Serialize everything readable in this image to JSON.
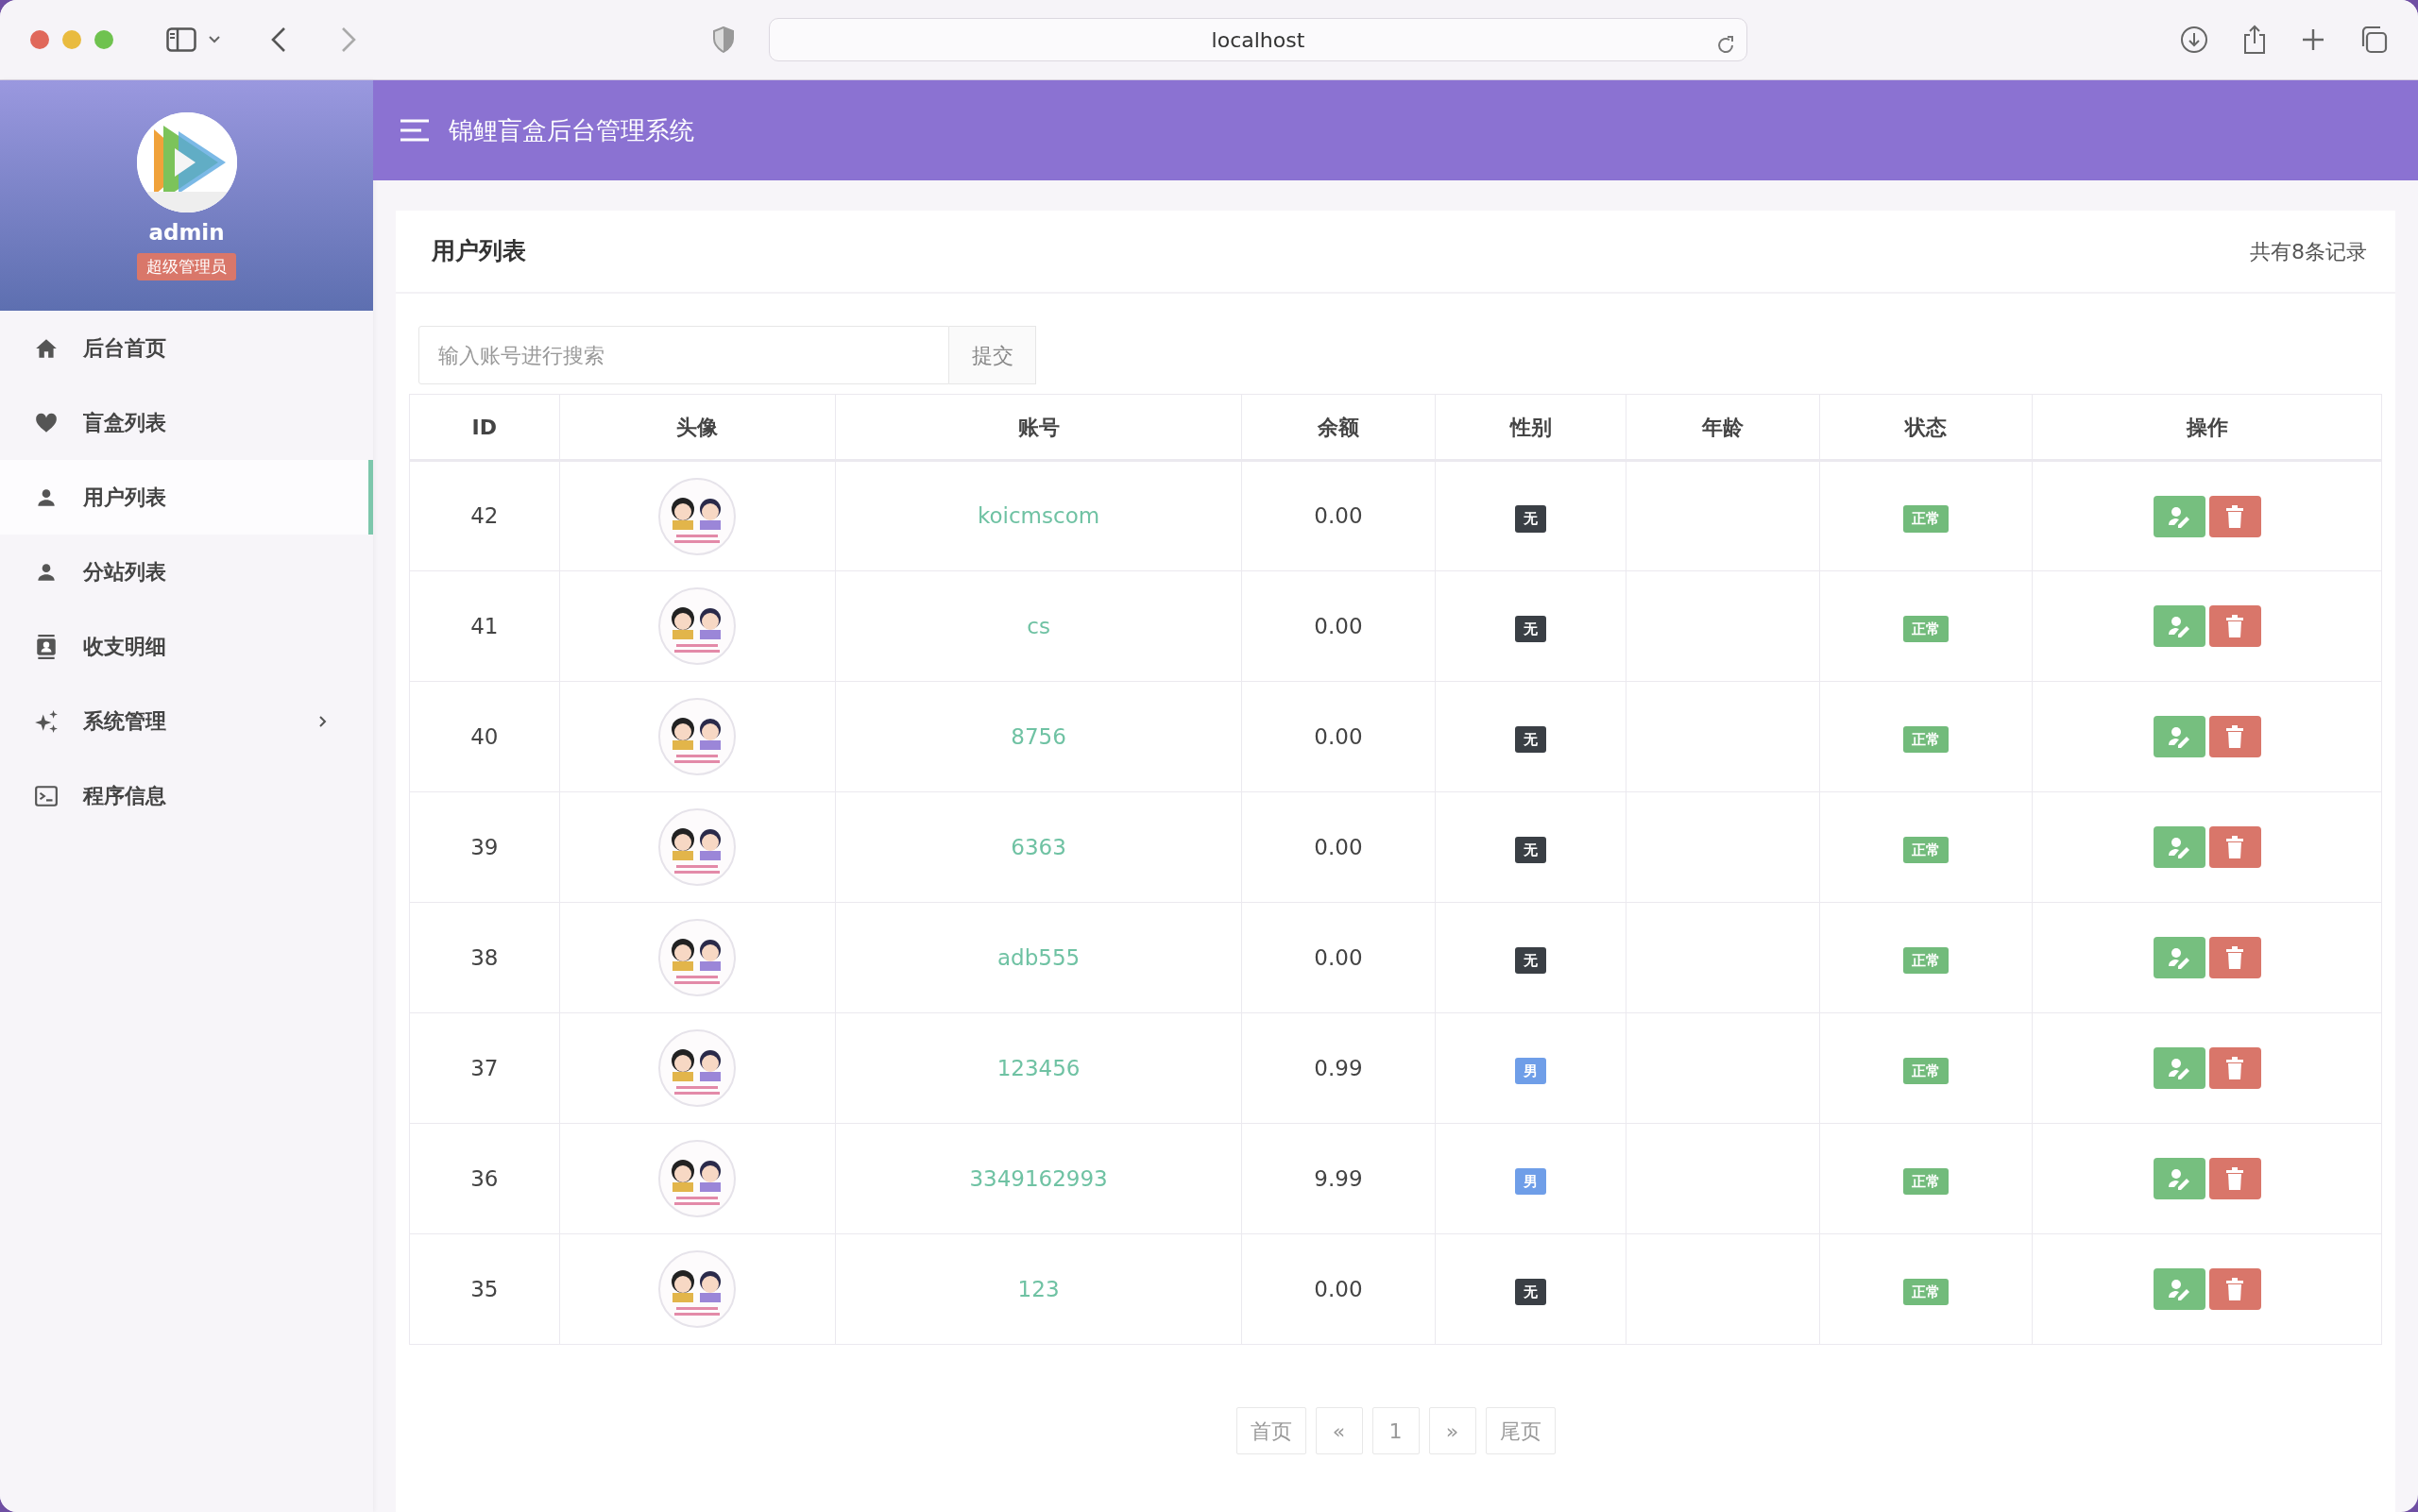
{
  "browser": {
    "url": "localhost"
  },
  "sidebar": {
    "user": {
      "name": "admin",
      "role": "超级管理员"
    },
    "items": [
      {
        "label": "后台首页",
        "kind": "home",
        "selected": false,
        "has_submenu": false
      },
      {
        "label": "盲盒列表",
        "kind": "heart",
        "selected": false,
        "has_submenu": false
      },
      {
        "label": "用户列表",
        "kind": "person",
        "selected": true,
        "has_submenu": false
      },
      {
        "label": "分站列表",
        "kind": "person",
        "selected": false,
        "has_submenu": false
      },
      {
        "label": "收支明细",
        "kind": "contact",
        "selected": false,
        "has_submenu": false
      },
      {
        "label": "系统管理",
        "kind": "sparkle",
        "selected": false,
        "has_submenu": true
      },
      {
        "label": "程序信息",
        "kind": "terminal",
        "selected": false,
        "has_submenu": false
      }
    ]
  },
  "header": {
    "title": "锦鲤盲盒后台管理系统"
  },
  "card": {
    "title": "用户列表",
    "count": "共有8条记录"
  },
  "search": {
    "placeholder": "输入账号进行搜索",
    "button": "提交"
  },
  "table": {
    "columns": [
      "ID",
      "头像",
      "账号",
      "余额",
      "性别",
      "年龄",
      "状态",
      "操作"
    ],
    "rows": [
      {
        "id": "42",
        "account": "koicmscom",
        "balance": "0.00",
        "gender": {
          "label": "无",
          "color": "#3a3f45"
        },
        "status": {
          "label": "正常",
          "color": "#72bb7b"
        }
      },
      {
        "id": "41",
        "account": "cs",
        "balance": "0.00",
        "gender": {
          "label": "无",
          "color": "#3a3f45"
        },
        "status": {
          "label": "正常",
          "color": "#72bb7b"
        }
      },
      {
        "id": "40",
        "account": "8756",
        "balance": "0.00",
        "gender": {
          "label": "无",
          "color": "#3a3f45"
        },
        "status": {
          "label": "正常",
          "color": "#72bb7b"
        }
      },
      {
        "id": "39",
        "account": "6363",
        "balance": "0.00",
        "gender": {
          "label": "无",
          "color": "#3a3f45"
        },
        "status": {
          "label": "正常",
          "color": "#72bb7b"
        }
      },
      {
        "id": "38",
        "account": "adb555",
        "balance": "0.00",
        "gender": {
          "label": "无",
          "color": "#3a3f45"
        },
        "status": {
          "label": "正常",
          "color": "#72bb7b"
        }
      },
      {
        "id": "37",
        "account": "123456",
        "balance": "0.99",
        "gender": {
          "label": "男",
          "color": "#6f9ee8"
        },
        "status": {
          "label": "正常",
          "color": "#72bb7b"
        }
      },
      {
        "id": "36",
        "account": "3349162993",
        "balance": "9.99",
        "gender": {
          "label": "男",
          "color": "#6f9ee8"
        },
        "status": {
          "label": "正常",
          "color": "#72bb7b"
        }
      },
      {
        "id": "35",
        "account": "123",
        "balance": "0.00",
        "gender": {
          "label": "无",
          "color": "#3a3f45"
        },
        "status": {
          "label": "正常",
          "color": "#72bb7b"
        }
      }
    ]
  },
  "pagination": [
    {
      "label": "首页",
      "selected": false
    },
    {
      "label": "«",
      "selected": false
    },
    {
      "label": "1",
      "selected": false
    },
    {
      "label": "»",
      "selected": false
    },
    {
      "label": "尾页",
      "selected": false
    }
  ]
}
